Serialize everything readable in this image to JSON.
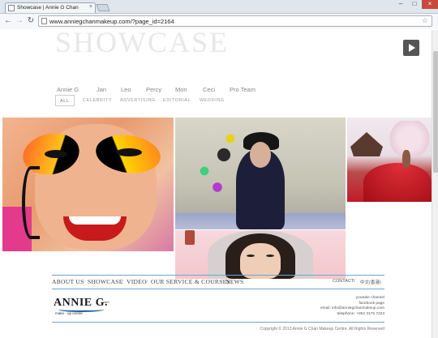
{
  "browser": {
    "tab_title": "Showcase | Annie G Chan",
    "tab_close": "×",
    "url": "www.anniegchanmakeup.com/?page_id=2164",
    "back_icon": "arrow-left-icon",
    "forward_icon": "arrow-right-icon",
    "reload_icon": "reload-icon",
    "star_icon": "star-icon",
    "window_min": "–",
    "window_max": "□",
    "window_close": "×"
  },
  "page": {
    "title": "SHOWCASE",
    "artists": [
      "Annie G",
      "Jan",
      "Leo",
      "Percy",
      "Mon",
      "Ceci",
      "Pro Team"
    ],
    "filters": [
      "ALL",
      "CELEBRITY",
      "ADVERTISING",
      "EDITORIAL",
      "WEDDING"
    ],
    "active_filter": "ALL"
  },
  "footer": {
    "nav": [
      "ABOUT US",
      "SHOWCASE",
      "VIDEO",
      "OUR SERVICE & COURSES",
      "NEWS"
    ],
    "separator": "/",
    "contact_link": "CONTACT",
    "language_link": "中文(香港)",
    "logo_name": "ANNIE G.",
    "logo_sub": "make - up centre",
    "logo_com": ".com",
    "contact_lines": [
      "youtube channel",
      "facebook page",
      "email: info@anniegchanmakeup.com",
      "telephone: +852 3176 7223"
    ],
    "copyright": "Copyright © 2013 Annie G Chan Makeup Centre. All Rights Reserved"
  },
  "colors": {
    "accent_line": "#6aa7cf",
    "logo_blue": "#1d5fa6",
    "close_red": "#c84a3c"
  }
}
